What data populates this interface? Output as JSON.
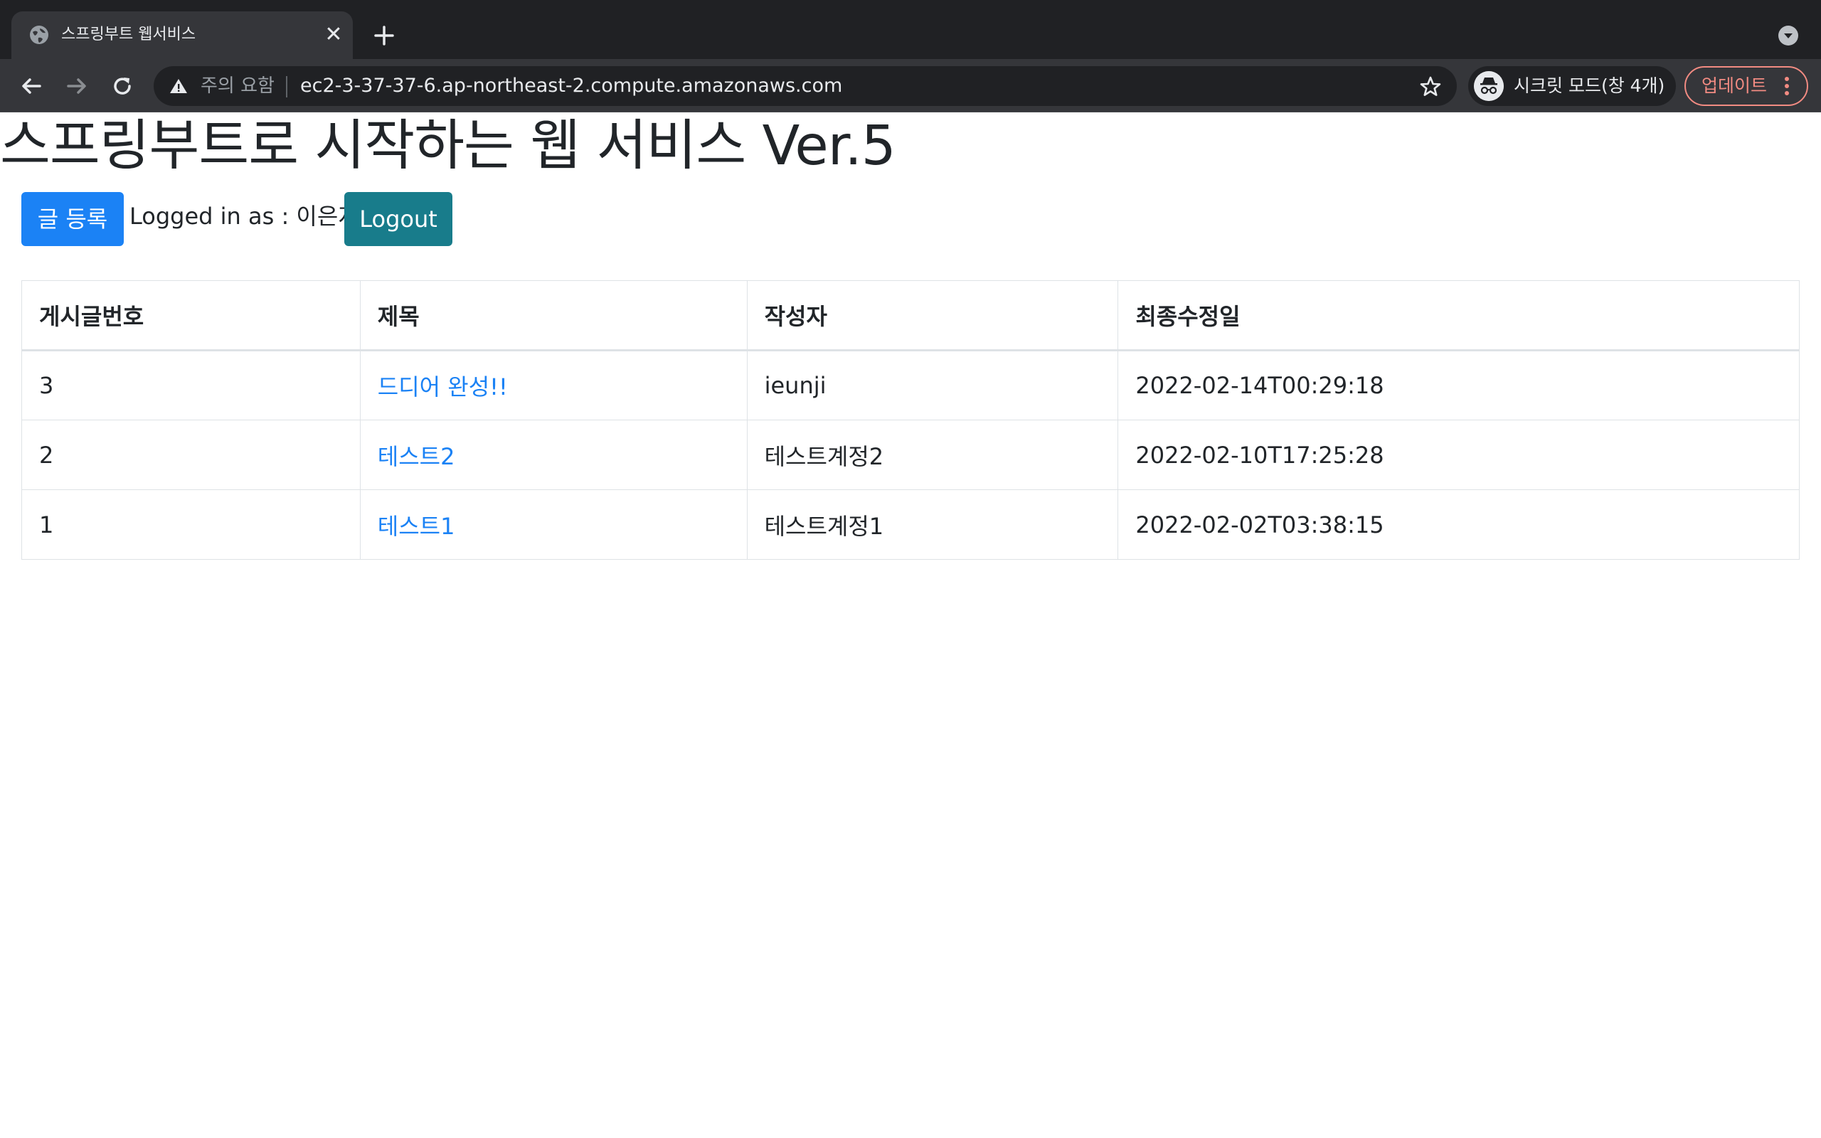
{
  "browser": {
    "tab_title": "스프링부트 웹서비스",
    "security_warning": "주의 요함",
    "url": "ec2-3-37-37-6.ap-northeast-2.compute.amazonaws.com",
    "incognito_label": "시크릿 모드(창 4개)",
    "update_label": "업데이트",
    "icons": [
      "globe-icon",
      "close-icon",
      "plus-icon",
      "chevron-down-icon",
      "back-arrow-icon",
      "forward-arrow-icon",
      "reload-icon",
      "warning-icon",
      "star-icon",
      "incognito-icon",
      "more-vert-icon"
    ]
  },
  "page": {
    "title": "스프링부트로 시작하는 웹 서비스 Ver.5",
    "register_button": "글 등록",
    "logged_in_as": "Logged in as : 이은지",
    "logout_button": "Logout"
  },
  "table": {
    "headers": [
      "게시글번호",
      "제목",
      "작성자",
      "최종수정일"
    ],
    "rows": [
      {
        "id": "3",
        "title": "드디어 완성!!",
        "author": "ieunji",
        "modified": "2022-02-14T00:29:18"
      },
      {
        "id": "2",
        "title": "테스트2",
        "author": "테스트계정2",
        "modified": "2022-02-10T17:25:28"
      },
      {
        "id": "1",
        "title": "테스트1",
        "author": "테스트계정1",
        "modified": "2022-02-02T03:38:15"
      }
    ]
  },
  "colors": {
    "primary": "#1b82f5",
    "info": "#187c8b",
    "chrome_dark": "#202124",
    "chrome_toolbar": "#35363a",
    "update_accent": "#f28b82"
  }
}
